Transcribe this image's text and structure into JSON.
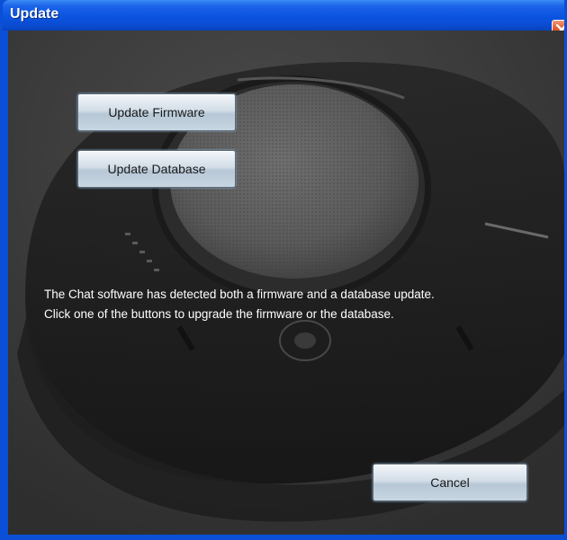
{
  "window": {
    "title": "Update",
    "close_icon": "close-icon"
  },
  "buttons": {
    "update_firmware": "Update Firmware",
    "update_database": "Update Database",
    "cancel": "Cancel"
  },
  "message": {
    "line1": "The Chat software has detected both a firmware and a database update.",
    "line2": "Click one of the buttons to upgrade the firmware or the database."
  },
  "colors": {
    "titlebar": "#0a54e0",
    "close_button": "#e0552c",
    "background": "#3c3c3c",
    "text": "#ffffff"
  }
}
